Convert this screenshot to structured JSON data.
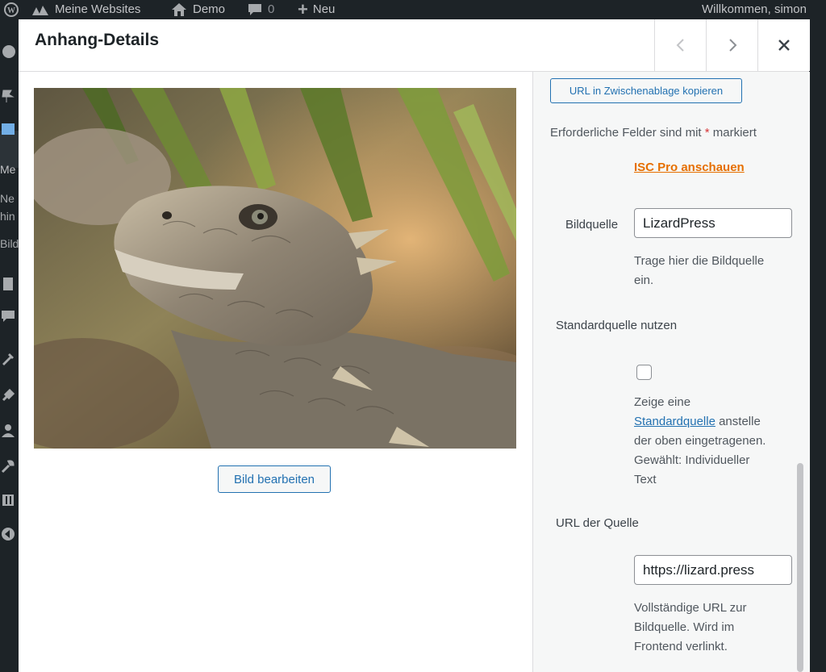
{
  "admin_bar": {
    "sites": "Meine Websites",
    "site": "Demo",
    "comments": "0",
    "new": "Neu",
    "welcome": "Willkommen, simon"
  },
  "sidebar": {
    "fragments": [
      "Me",
      "Ne",
      "hin",
      "Bild"
    ]
  },
  "modal": {
    "title": "Anhang-Details",
    "prev_icon": "chevron-left-icon",
    "next_icon": "chevron-right-icon",
    "close_icon": "close-icon"
  },
  "preview": {
    "image_alt": "Eidechse",
    "edit_button": "Bild bearbeiten"
  },
  "details": {
    "copy_url_button": "URL in Zwischenablage kopieren",
    "required_text": "Erforderliche Felder sind mit",
    "required_star": "*",
    "required_after": "markiert",
    "pro_link": "ISC Pro anschauen",
    "source_label": "Bildquelle",
    "source_value": "LizardPress",
    "source_help_1": "Trage hier die Bildquelle",
    "source_help_2": "ein.",
    "standard_label": "Standardquelle nutzen",
    "standard_checked": false,
    "standard_help_1": "Zeige eine",
    "standard_help_link": "Standardquelle",
    "standard_help_2": "anstelle",
    "standard_help_3": "der oben eingetragenen.",
    "standard_help_4": "Gewählt: Individueller",
    "standard_help_5": "Text",
    "url_label": "URL der Quelle",
    "url_value": "https://lizard.press",
    "url_help_1": "Vollständige URL zur",
    "url_help_2": "Bildquelle. Wird im",
    "url_help_3": "Frontend verlinkt."
  }
}
